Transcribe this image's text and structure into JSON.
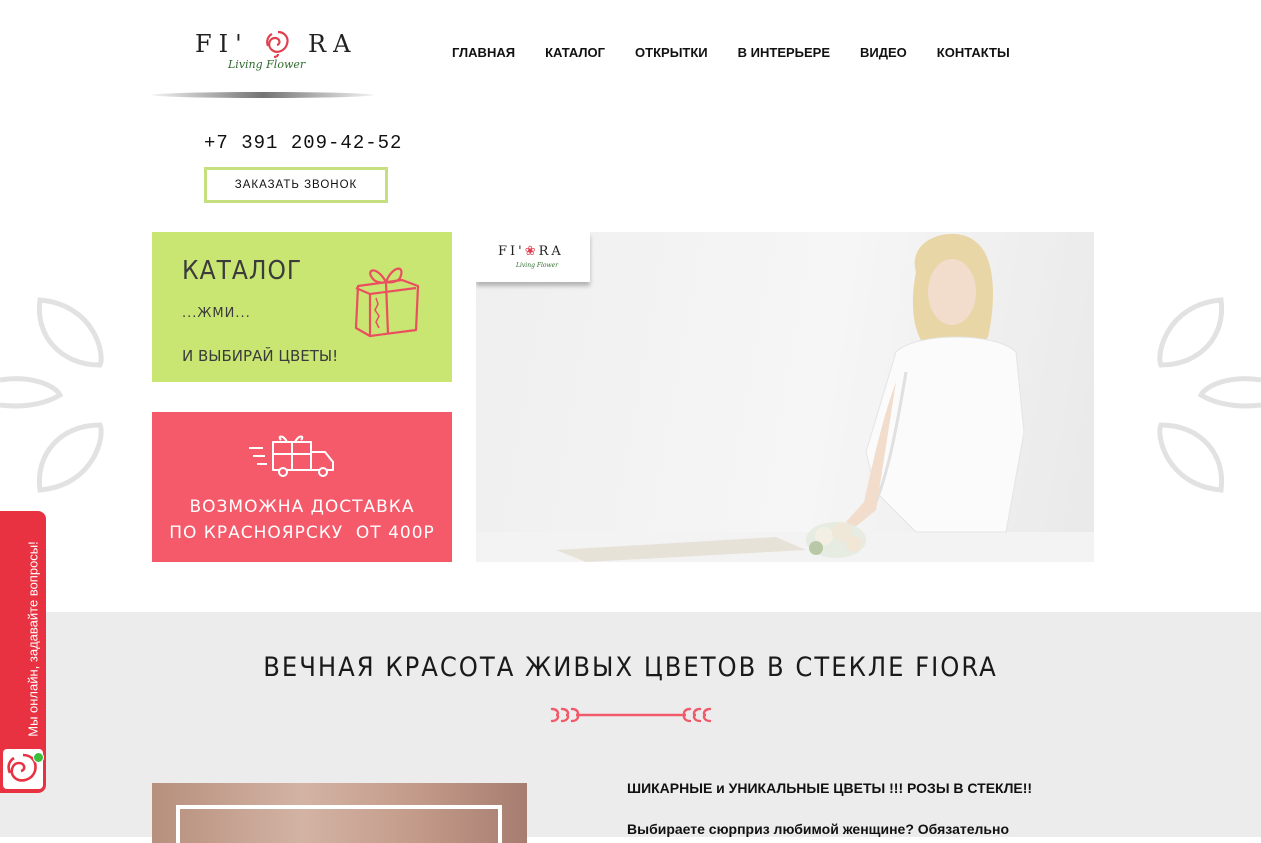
{
  "header": {
    "logo_left": "FI'",
    "logo_right": "RA",
    "logo_sub": "Living Flower",
    "nav": [
      "ГЛАВНАЯ",
      "КАТАЛОГ",
      "ОТКРЫТКИ",
      "В ИНТЕРЬЕРЕ",
      "ВИДЕО",
      "КОНТАКТЫ"
    ],
    "phone": "+7 391 209-42-52",
    "callback_label": "ЗАКАЗАТЬ ЗВОНОК"
  },
  "cards": {
    "catalog": {
      "title": "КАТАЛОГ",
      "line2": "...ЖМИ...",
      "line3": "И ВЫБИРАЙ ЦВЕТЫ!"
    },
    "delivery": {
      "line1": "ВОЗМОЖНА ДОСТАВКА",
      "line2": "ПО КРАСНОЯРСКУ  ОТ 400Р"
    }
  },
  "hero": {
    "logo_left": "FI'",
    "logo_right": "RA",
    "logo_sub": "Living Flower"
  },
  "section": {
    "title": "ВЕЧНАЯ КРАСОТА ЖИВЫХ ЦВЕТОВ В СТЕКЛЕ FIORA",
    "heading": "ШИКАРНЫЕ и УНИКАЛЬНЫЕ ЦВЕТЫ !!! РОЗЫ В СТЕКЛЕ!!",
    "paragraph": "Выбираете сюрприз любимой женщине? Обязательно"
  },
  "chat_widget": {
    "label": "Мы онлайн, задавайте вопросы!"
  },
  "colors": {
    "accent_green": "#c9e672",
    "accent_red": "#f45a6a",
    "brand_rose": "#e0404f",
    "band_gray": "#ececec"
  }
}
